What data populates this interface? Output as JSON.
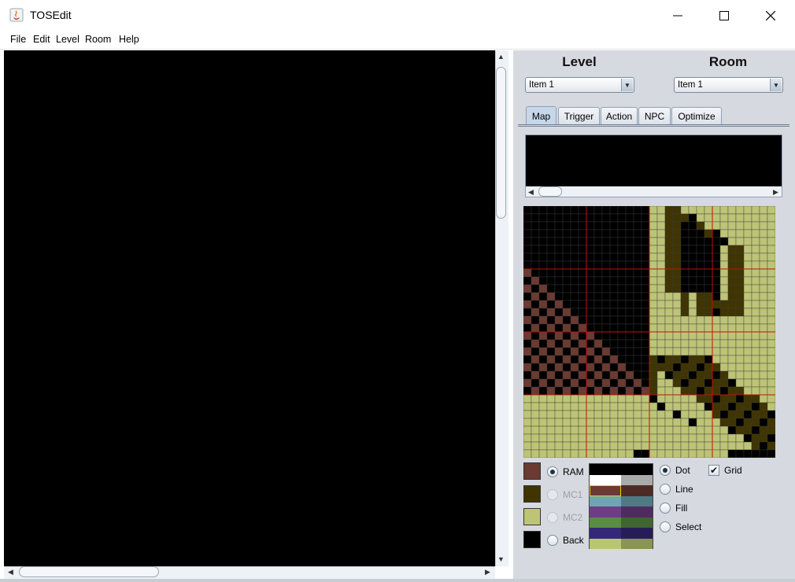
{
  "window": {
    "title": "TOSEdit"
  },
  "menu": [
    "File",
    "Edit",
    "Level",
    "Room",
    "Help"
  ],
  "level": {
    "header": "Level",
    "selected": "Item 1"
  },
  "room": {
    "header": "Room",
    "selected": "Item 1"
  },
  "tabs": [
    {
      "label": "Map",
      "active": true
    },
    {
      "label": "Trigger",
      "active": false
    },
    {
      "label": "Action",
      "active": false
    },
    {
      "label": "NPC",
      "active": false
    },
    {
      "label": "Optimize",
      "active": false
    }
  ],
  "colors": {
    "ram": "#6b3a31",
    "mc1": "#403500",
    "mc2": "#bec476",
    "back": "#000000",
    "grid_line": "#c8c8c8",
    "grid_major": "#c01010",
    "panel_bg": "#d6d9df"
  },
  "color_modes": [
    {
      "label": "RAM",
      "selected": true,
      "enabled": true
    },
    {
      "label": "MC1",
      "selected": false,
      "enabled": false
    },
    {
      "label": "MC2",
      "selected": false,
      "enabled": false
    },
    {
      "label": "Back",
      "selected": false,
      "enabled": true
    }
  ],
  "draw_tools": [
    {
      "label": "Dot",
      "selected": true
    },
    {
      "label": "Line",
      "selected": false
    },
    {
      "label": "Fill",
      "selected": false
    },
    {
      "label": "Select",
      "selected": false
    }
  ],
  "grid_option": {
    "label": "Grid",
    "checked": true
  },
  "palette": [
    [
      "#000000",
      "#000000"
    ],
    [
      "#ffffff",
      "#aaaaaa"
    ],
    [
      "#6b3a31",
      "#4d2b25"
    ],
    [
      "#70a4b2",
      "#4f7a85"
    ],
    [
      "#6f3d86",
      "#4f2c60"
    ],
    [
      "#588d43",
      "#3f6530"
    ],
    [
      "#352879",
      "#261d58"
    ],
    [
      "#b8c76f",
      "#8a9553"
    ]
  ],
  "palette_selected": [
    2,
    0
  ]
}
